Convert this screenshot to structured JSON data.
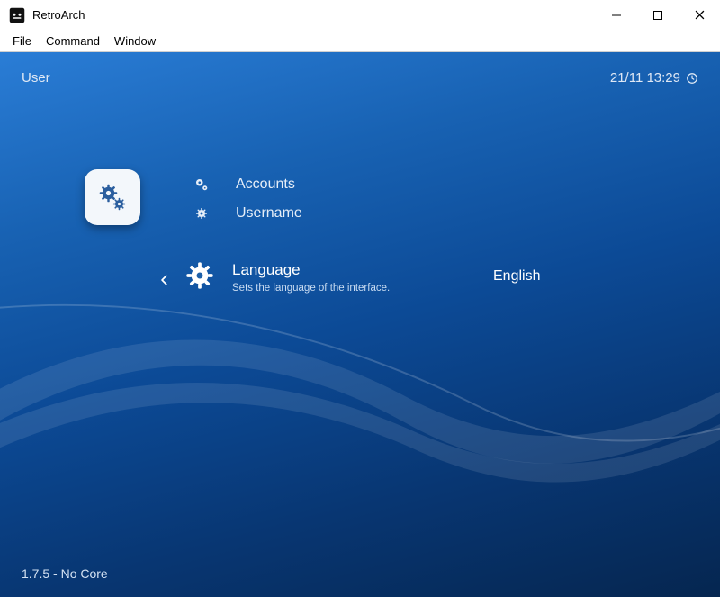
{
  "window": {
    "title": "RetroArch"
  },
  "menubar": {
    "items": [
      "File",
      "Command",
      "Window"
    ]
  },
  "header": {
    "section": "User",
    "datetime": "21/11 13:29"
  },
  "options": {
    "accounts": {
      "label": "Accounts"
    },
    "username": {
      "label": "Username"
    },
    "language": {
      "label": "Language",
      "description": "Sets the language of the interface.",
      "value": "English"
    }
  },
  "footer": {
    "status": "1.7.5 - No Core"
  }
}
